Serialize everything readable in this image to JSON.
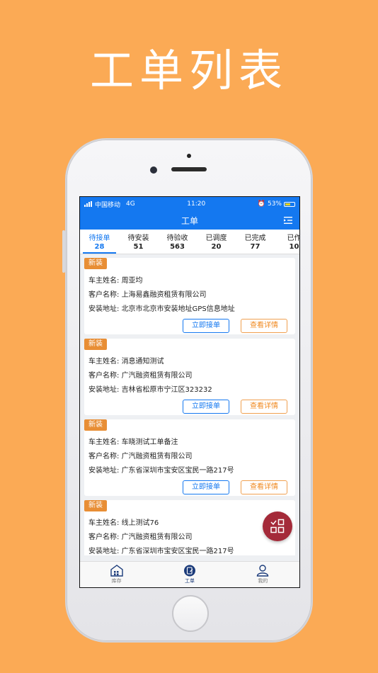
{
  "headline": "工单列表",
  "status_bar": {
    "carrier": "中国移动",
    "network": "4G",
    "time": "11:20",
    "battery": "53%"
  },
  "nav": {
    "title": "工单"
  },
  "tabs": [
    {
      "label": "待接单",
      "count": "28"
    },
    {
      "label": "待安装",
      "count": "51"
    },
    {
      "label": "待验收",
      "count": "563"
    },
    {
      "label": "已调度",
      "count": "20"
    },
    {
      "label": "已完成",
      "count": "77"
    },
    {
      "label": "已作",
      "count": "10"
    }
  ],
  "field_labels": {
    "owner": "车主姓名:",
    "customer": "客户名称:",
    "address": "安装地址:"
  },
  "buttons": {
    "accept": "立即接单",
    "detail": "查看详情"
  },
  "orders": [
    {
      "badge": "新装",
      "owner": "周亚均",
      "customer": "上海易鑫融资租赁有限公司",
      "address": "北京市北京市安装地址GPS信息地址"
    },
    {
      "badge": "新装",
      "owner": "消息通知测试",
      "customer": "广汽融资租赁有限公司",
      "address": "吉林省松原市宁江区323232"
    },
    {
      "badge": "新装",
      "owner": "车晓测试工单备注",
      "customer": "广汽融资租赁有限公司",
      "address": "广东省深圳市宝安区宝民一路217号"
    },
    {
      "badge": "新装",
      "owner": "线上测试76",
      "customer": "广汽融资租赁有限公司",
      "address": "广东省深圳市宝安区宝民一路217号"
    }
  ],
  "bottom_nav": [
    {
      "label": "库存",
      "icon": "warehouse-icon"
    },
    {
      "label": "工单",
      "icon": "workorder-icon"
    },
    {
      "label": "我的",
      "icon": "user-icon"
    }
  ],
  "colors": {
    "background": "#FBAA55",
    "primary": "#1478f0",
    "badge": "#e88e35",
    "fab": "#a42a39"
  }
}
